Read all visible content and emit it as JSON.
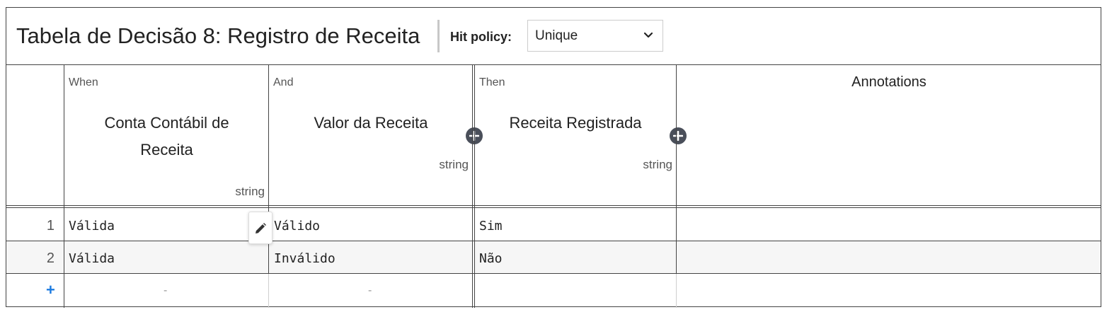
{
  "header": {
    "title": "Tabela de Decisão 8: Registro de Receita",
    "hit_policy_label": "Hit policy:",
    "hit_policy_value": "Unique"
  },
  "columns": [
    {
      "kind": "When",
      "label_lines": [
        "Conta Contábil de",
        "Receita"
      ],
      "type": "string"
    },
    {
      "kind": "And",
      "label_lines": [
        "Valor da Receita"
      ],
      "type": "string"
    },
    {
      "kind": "Then",
      "label_lines": [
        "Receita Registrada"
      ],
      "type": "string"
    }
  ],
  "annotations_label": "Annotations",
  "rows": [
    {
      "num": "1",
      "cells": [
        "Válida",
        "Válido",
        "Sim",
        ""
      ]
    },
    {
      "num": "2",
      "cells": [
        "Válida",
        "Inválido",
        "Não",
        ""
      ]
    }
  ],
  "new_row": {
    "add_symbol": "+",
    "placeholder": "-"
  },
  "icons": {
    "add_column": "plus-circle-icon",
    "edit": "pencil-icon",
    "select": "chevron-down-icon"
  },
  "colors": {
    "border": "#444444",
    "add_button": "#4a4f5a",
    "add_row": "#1c7be0",
    "alt_row": "#f6f6f6"
  }
}
